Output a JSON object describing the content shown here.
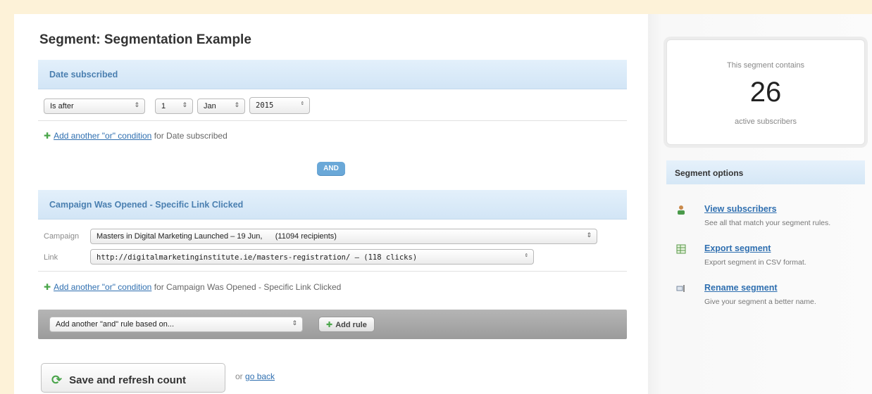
{
  "page_title": "Segment: Segmentation Example",
  "rule1": {
    "header": "Date subscribed",
    "operator": "Is after",
    "day": "1",
    "month": "Jan",
    "year": "2015",
    "add_or_link": "Add another \"or\" condition",
    "add_or_suffix": "for Date subscribed"
  },
  "and_badge": "AND",
  "rule2": {
    "header": "Campaign Was Opened - Specific Link Clicked",
    "campaign_label": "Campaign",
    "campaign_value": "Masters in Digital Marketing Launched – 19 Jun,      (11094 recipients)",
    "link_label": "Link",
    "link_value": "http://digitalmarketinginstitute.ie/masters-registration/ – (118 clicks)",
    "add_or_link": "Add another \"or\" condition",
    "add_or_suffix": "for Campaign Was Opened - Specific Link Clicked"
  },
  "and_rule": {
    "select_value": "Add another \"and\" rule based on...",
    "add_rule_label": "Add rule"
  },
  "save_label": "Save and refresh count",
  "or_text": "or",
  "go_back_label": "go back",
  "sidebar": {
    "count_label": "This segment contains",
    "count": "26",
    "count_sub": "active subscribers",
    "options_header": "Segment options",
    "options": [
      {
        "title": "View subscribers",
        "desc": "See all that match your segment rules.",
        "icon": "users-icon"
      },
      {
        "title": "Export segment",
        "desc": "Export segment in CSV format.",
        "icon": "spreadsheet-icon"
      },
      {
        "title": "Rename segment",
        "desc": "Give your segment a better name.",
        "icon": "rename-icon"
      }
    ]
  },
  "colors": {
    "background": "#fdf2d8",
    "header_blue": "#d2e5f6",
    "link_blue": "#2f6fb0",
    "and_badge": "#6aa8d8",
    "plus_green": "#4aa64a"
  }
}
